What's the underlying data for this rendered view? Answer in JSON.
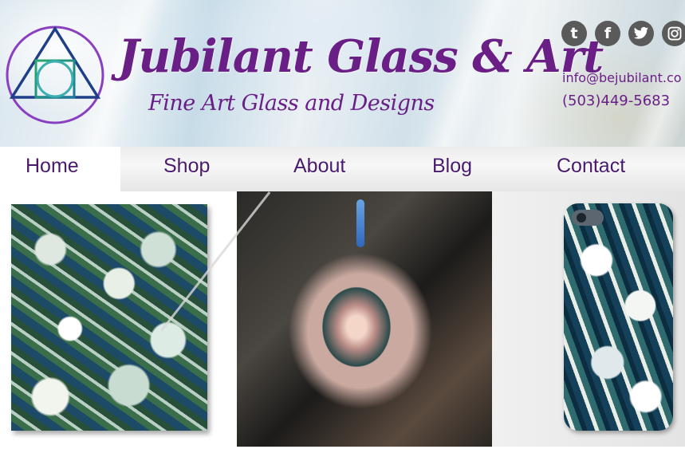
{
  "header": {
    "brand_title": "Jubilant Glass & Art",
    "brand_tagline": "Fine Art Glass and Designs",
    "logo_icon": "sacred-geometry-logo-icon",
    "social": [
      {
        "name": "tumblr-icon",
        "glyph": "t"
      },
      {
        "name": "facebook-icon",
        "glyph": "f"
      },
      {
        "name": "twitter-icon",
        "glyph": "🐦"
      },
      {
        "name": "instagram-icon",
        "glyph": "◎"
      }
    ],
    "email": "info@bejubilant.co",
    "phone": "(503)449-5683"
  },
  "nav": {
    "items": [
      {
        "label": "Home",
        "active": true
      },
      {
        "label": "Shop",
        "active": false
      },
      {
        "label": "About",
        "active": false
      },
      {
        "label": "Blog",
        "active": false
      },
      {
        "label": "Contact",
        "active": false
      }
    ]
  },
  "gallery": {
    "images": [
      {
        "name": "glass-swirl-art-image"
      },
      {
        "name": "glass-pendant-image"
      },
      {
        "name": "phone-case-image"
      }
    ]
  },
  "colors": {
    "brand_purple": "#6a1f86",
    "nav_text": "#4a1a6e",
    "social_gray": "#5a5a5a"
  }
}
